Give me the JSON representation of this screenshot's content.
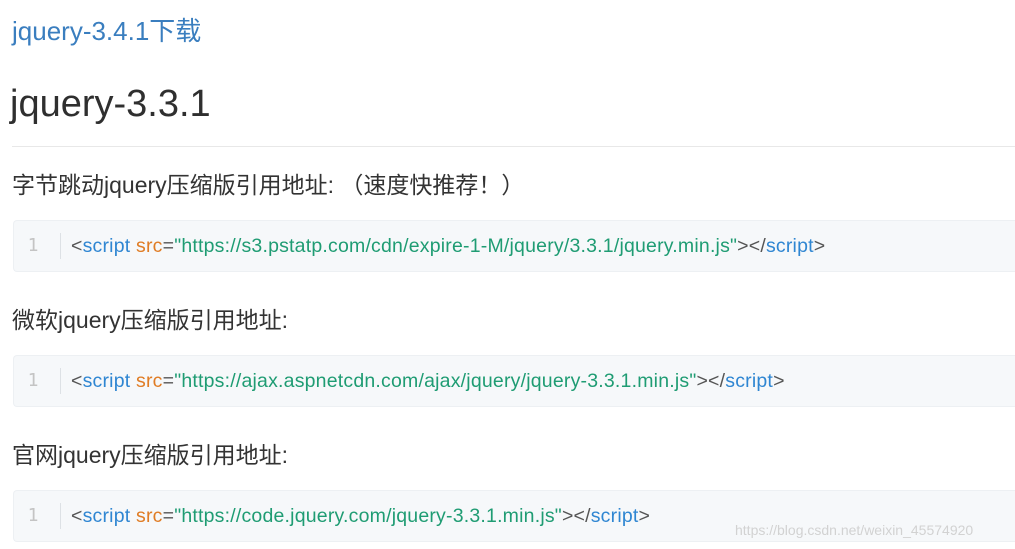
{
  "header": {
    "download_link": "jquery-3.4.1下载",
    "version_title": "jquery-3.3.1"
  },
  "sections": [
    {
      "label": "字节跳动jquery压缩版引用地址: （速度快推荐！）",
      "line_number": "1",
      "code": {
        "open_bracket": "<",
        "tag": "script",
        "space": " ",
        "attr": "src",
        "equals": "=",
        "value": "\"https://s3.pstatp.com/cdn/expire-1-M/jquery/3.3.1/jquery.min.js\"",
        "mid": "></",
        "close_tag": "script",
        "close_bracket": ">"
      }
    },
    {
      "label": "微软jquery压缩版引用地址:",
      "line_number": "1",
      "code": {
        "open_bracket": "<",
        "tag": "script",
        "space": " ",
        "attr": "src",
        "equals": "=",
        "value": "\"https://ajax.aspnetcdn.com/ajax/jquery/jquery-3.3.1.min.js\"",
        "mid": "></",
        "close_tag": "script",
        "close_bracket": ">"
      }
    },
    {
      "label": "官网jquery压缩版引用地址:",
      "line_number": "1",
      "code": {
        "open_bracket": "<",
        "tag": "script",
        "space": " ",
        "attr": "src",
        "equals": "=",
        "value": "\"https://code.jquery.com/jquery-3.3.1.min.js\"",
        "mid": "></",
        "close_tag": "script",
        "close_bracket": ">"
      }
    }
  ],
  "watermark": "https://blog.csdn.net/weixin_45574920",
  "colors": {
    "link": "#3a7ebf",
    "code_tag": "#2f86d2",
    "code_attr": "#e07c24",
    "code_string": "#1f9c73",
    "code_background": "#f6f8fa"
  }
}
